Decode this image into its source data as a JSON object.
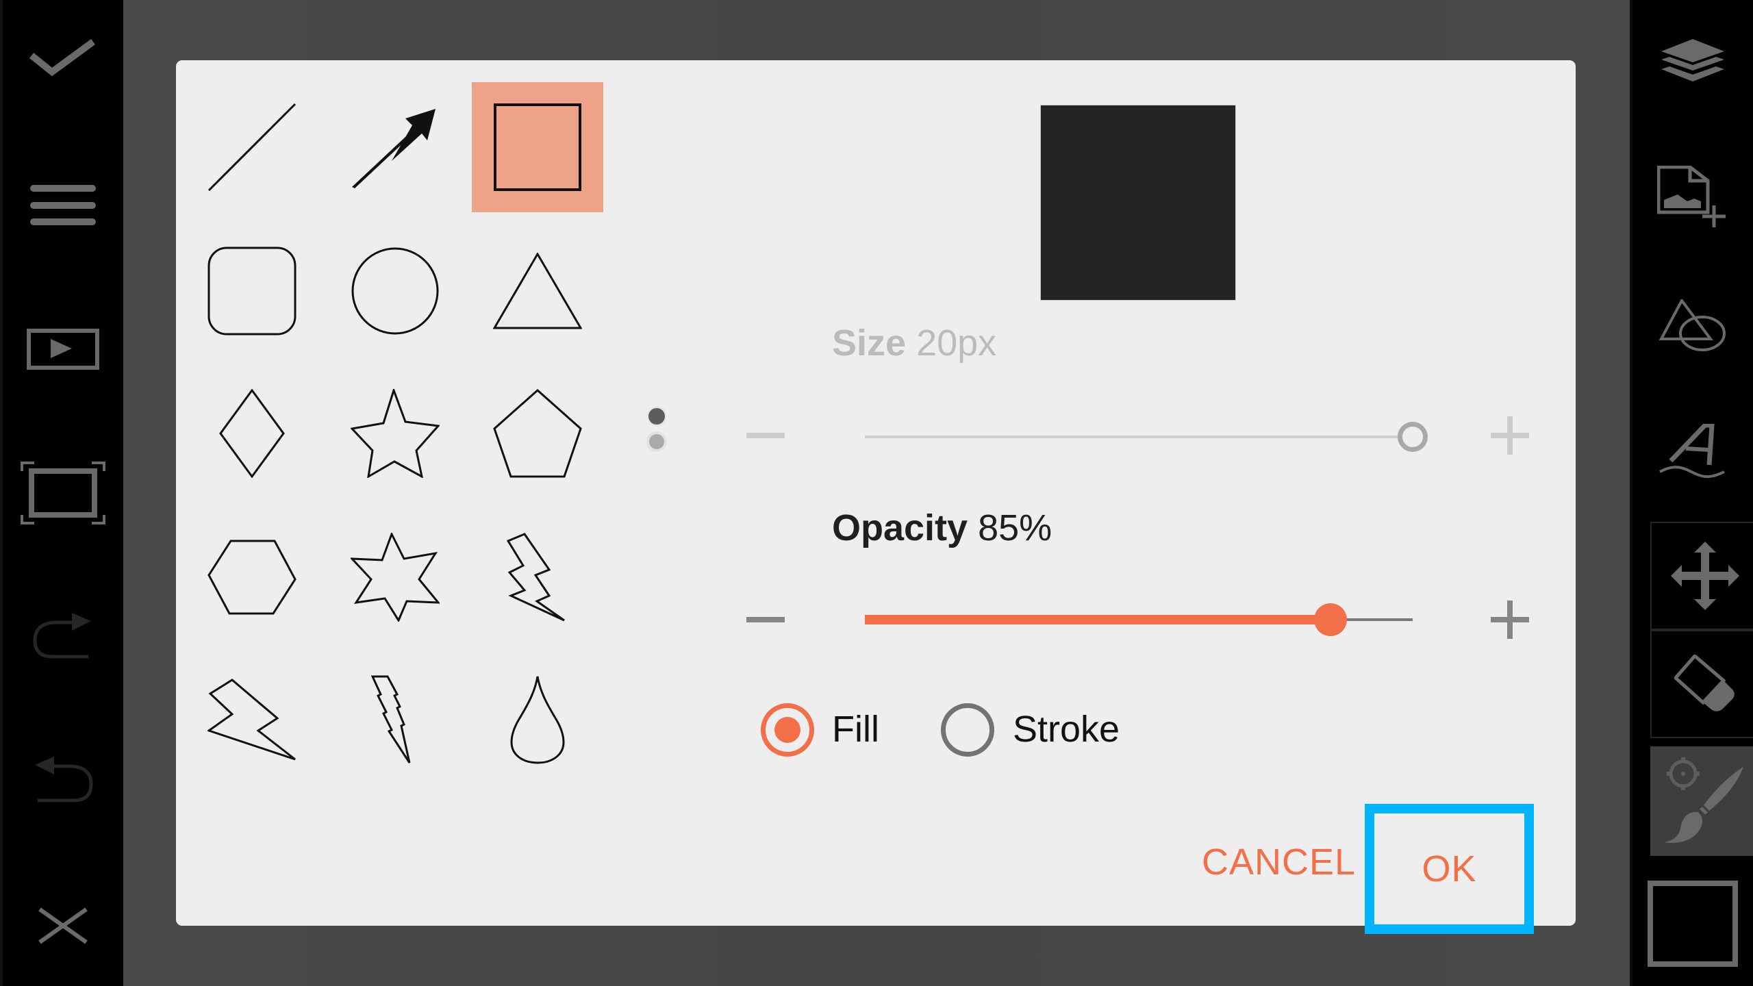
{
  "left_toolbar": {
    "items": [
      {
        "name": "confirm",
        "icon": "checkmark-icon"
      },
      {
        "name": "menu",
        "icon": "hamburger-menu-icon"
      },
      {
        "name": "play",
        "icon": "play-icon"
      },
      {
        "name": "fit-screen",
        "icon": "fullscreen-frame-icon"
      },
      {
        "name": "redo",
        "icon": "redo-icon"
      },
      {
        "name": "undo",
        "icon": "undo-icon"
      },
      {
        "name": "close",
        "icon": "close-icon"
      }
    ]
  },
  "right_toolbar": {
    "items": [
      {
        "name": "layers",
        "icon": "layers-icon"
      },
      {
        "name": "add-image",
        "icon": "add-image-icon"
      },
      {
        "name": "shapes",
        "icon": "shapes-icon"
      },
      {
        "name": "text",
        "icon": "text-icon"
      },
      {
        "name": "move",
        "icon": "move-icon"
      },
      {
        "name": "eraser",
        "icon": "eraser-icon"
      },
      {
        "name": "brush",
        "icon": "brush-settings-icon",
        "active": true
      },
      {
        "name": "color",
        "icon": "color-swatch-icon"
      }
    ]
  },
  "dialog": {
    "shapes": [
      {
        "name": "line"
      },
      {
        "name": "arrow"
      },
      {
        "name": "rectangle",
        "selected": true
      },
      {
        "name": "rounded-rectangle"
      },
      {
        "name": "ellipse"
      },
      {
        "name": "triangle"
      },
      {
        "name": "diamond"
      },
      {
        "name": "five-point-star"
      },
      {
        "name": "pentagon"
      },
      {
        "name": "hexagon"
      },
      {
        "name": "six-point-star"
      },
      {
        "name": "lightning-bolt"
      },
      {
        "name": "lightning-bolt-wide"
      },
      {
        "name": "lightning-bolt-narrow"
      },
      {
        "name": "drop"
      }
    ],
    "pager": {
      "pages": 2,
      "current": 1
    },
    "preview": {
      "fill_color": "#242424"
    },
    "size": {
      "label": "Size",
      "value_text": "20px",
      "value": 20,
      "enabled": false,
      "fraction": 1.0
    },
    "opacity": {
      "label": "Opacity",
      "value_text": "85%",
      "value": 85,
      "enabled": true
    },
    "mode": {
      "options": [
        {
          "label": "Fill",
          "checked": true
        },
        {
          "label": "Stroke",
          "checked": false
        }
      ]
    },
    "buttons": {
      "cancel": "CANCEL",
      "ok": "OK"
    }
  },
  "colors": {
    "accent": "#f36f47",
    "selection": "#eea287",
    "highlight": "#00b4ff",
    "dialog_bg": "#eeeeee",
    "icon_grey": "#6a6a6a"
  }
}
